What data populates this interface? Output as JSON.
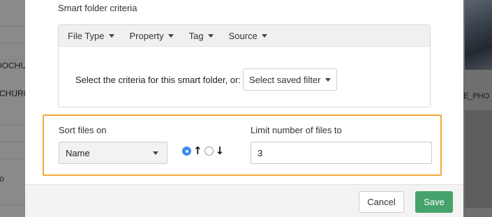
{
  "background": {
    "left_labels": [
      "DOCHUI",
      "CHURC",
      "o"
    ],
    "right_label": "E_PHO"
  },
  "modal": {
    "criteria_title": "Smart folder criteria",
    "tabs": [
      {
        "label": "File Type"
      },
      {
        "label": "Property"
      },
      {
        "label": "Tag"
      },
      {
        "label": "Source"
      }
    ],
    "criteria_prompt": "Select the criteria for this smart folder, or:",
    "saved_filter_label": "Select saved filter",
    "sort": {
      "label": "Sort files on",
      "value": "Name",
      "direction": "ascending",
      "ascending_arrow": "🡡",
      "descending_arrow": "🡣"
    },
    "limit": {
      "label": "Limit number of files to",
      "value": "3"
    },
    "footer": {
      "cancel_label": "Cancel",
      "save_label": "Save"
    },
    "colors": {
      "highlight_border": "#f0a93b",
      "save_button": "#46a26b",
      "radio_selected": "#3d8bf0"
    }
  }
}
